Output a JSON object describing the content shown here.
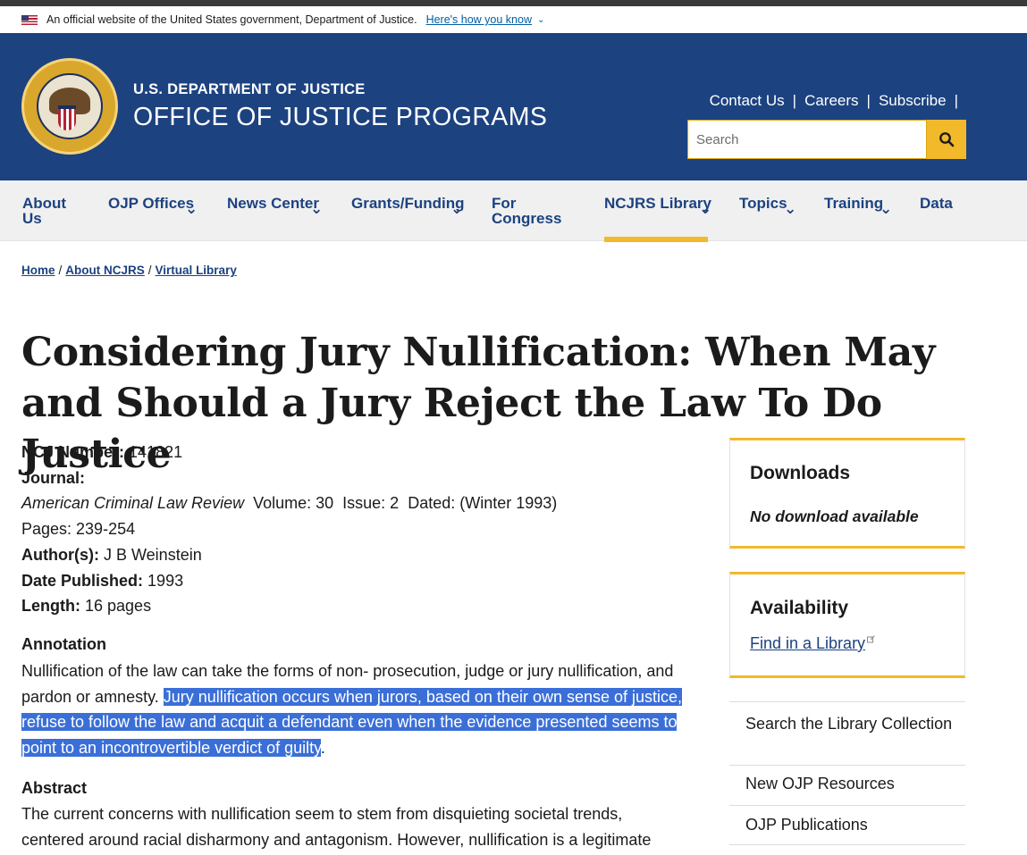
{
  "gov_banner": {
    "text": "An official website of the United States government, Department of Justice.",
    "link": "Here's how you know"
  },
  "header": {
    "agency_small": "U.S. DEPARTMENT OF JUSTICE",
    "agency_big": "OFFICE OF JUSTICE PROGRAMS",
    "links": [
      "Contact Us",
      "Careers",
      "Subscribe"
    ],
    "search_placeholder": "Search"
  },
  "nav": {
    "items": [
      {
        "line1": "About",
        "line2": "Us"
      },
      {
        "line1": "OJP Offices",
        "line2": ""
      },
      {
        "line1": "News Center",
        "line2": ""
      },
      {
        "line1": "Grants/Funding",
        "line2": ""
      },
      {
        "line1": "For",
        "line2": "Congress"
      },
      {
        "line1": "NCJRS Library",
        "line2": ""
      },
      {
        "line1": "Topics",
        "line2": ""
      },
      {
        "line1": "Training",
        "line2": ""
      },
      {
        "line1": "Data",
        "line2": ""
      }
    ]
  },
  "breadcrumb": [
    "Home",
    "About NCJRS",
    "Virtual Library"
  ],
  "title": "Considering Jury Nullification: When May and Should a Jury Reject the Law To Do Justice",
  "meta": {
    "ncj_label": "NCJ Number:",
    "ncj_value": "141821",
    "journal_label": "Journal:",
    "journal_name": "American Criminal Law Review",
    "journal_details": "Volume: 30  Issue: 2  Dated: (Winter 1993)",
    "pages": "Pages: 239-254",
    "authors_label": "Author(s):",
    "authors_value": "J B Weinstein",
    "date_label": "Date Published:",
    "date_value": "1993",
    "length_label": "Length:",
    "length_value": "16 pages"
  },
  "annotation": {
    "heading": "Annotation",
    "text_plain": "Nullification of the law can take the forms of non- prosecution, judge or jury nullification, and pardon or amnesty. ",
    "text_selected": "Jury nullification occurs when jurors, based on their own sense of justice, refuse to follow the law and acquit a defendant even when the evidence presented seems to point to an incontrovertible verdict of guilty",
    "text_end": "."
  },
  "abstract": {
    "heading": "Abstract",
    "text": "The current concerns with nullification seem to stem from disquieting societal trends, centered around racial disharmony and antagonism. However, nullification is a legitimate"
  },
  "sidebar": {
    "downloads_title": "Downloads",
    "downloads_text": "No download available",
    "availability_title": "Availability",
    "availability_link": "Find in a Library",
    "links": [
      "Search the Library Collection",
      "New OJP Resources",
      "OJP Publications"
    ]
  },
  "colors": {
    "header_blue": "#1c4280",
    "accent_gold": "#f2b92a",
    "selection_blue": "#3b6fd8"
  }
}
